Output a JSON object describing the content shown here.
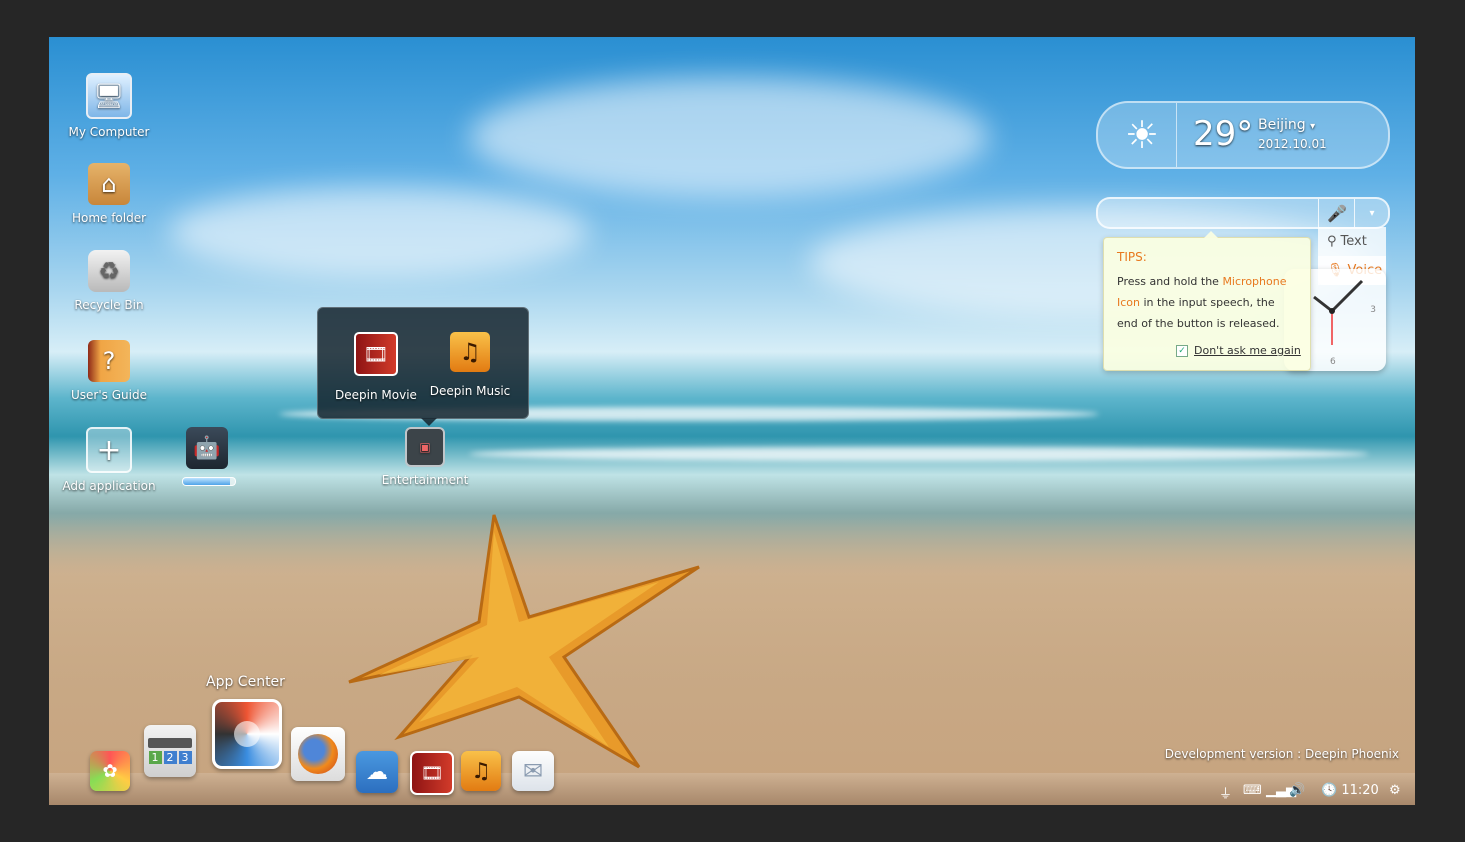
{
  "desktop": {
    "icons": [
      {
        "label": "My Computer"
      },
      {
        "label": "Home folder"
      },
      {
        "label": "Recycle Bin"
      },
      {
        "label": "User's Guide"
      },
      {
        "label": "Add application"
      }
    ],
    "install_progress": 0.9,
    "folder": {
      "label": "Entertainment",
      "apps": [
        {
          "label": "Deepin Movie"
        },
        {
          "label": "Deepin Music"
        }
      ]
    }
  },
  "weather": {
    "temperature": "29°",
    "city": "Beijing",
    "date": "2012.10.01"
  },
  "search": {
    "value": "",
    "menu": [
      {
        "label": "Text",
        "icon": "search-icon"
      },
      {
        "label": "Voice",
        "icon": "microphone-icon"
      }
    ],
    "tips": {
      "title": "TIPS:",
      "text_a": "Press and hold the ",
      "highlight_a": "Microphone",
      "highlight_b": "Icon",
      "text_b": " in the input speech, the end of the button is released.",
      "checkbox_label": "Don't ask me again",
      "checked": true
    },
    "colors": {
      "accent": "#e8791f"
    }
  },
  "clock": {
    "numerals": [
      "3",
      "6"
    ]
  },
  "dock": {
    "app_center_label": "App Center",
    "numbers": [
      "1",
      "2",
      "3"
    ]
  },
  "taskbar": {
    "version": "Development version : Deepin Phoenix",
    "time": "11:20"
  }
}
